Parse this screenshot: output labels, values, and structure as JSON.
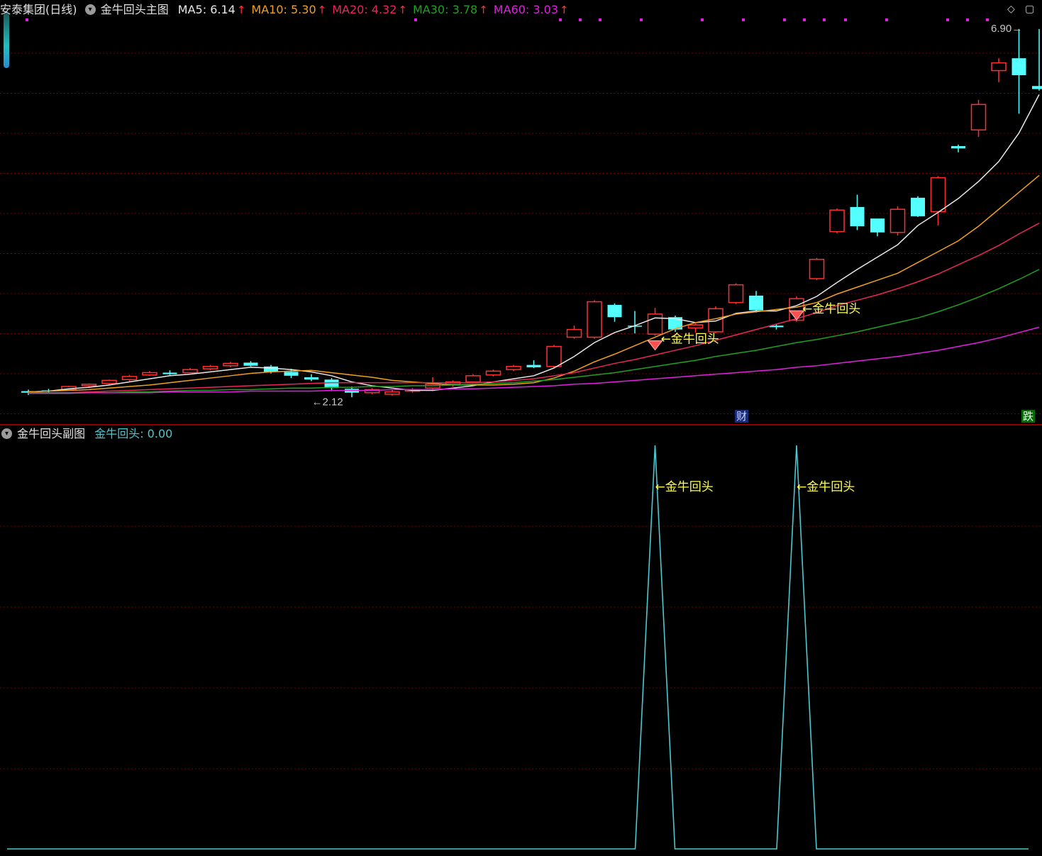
{
  "main_header": {
    "stock_title": "安泰集团(日线)",
    "indicator_name": "金牛回头主图",
    "ma_items": [
      {
        "label": "MA5: 6.14",
        "color": "#e8e8e8",
        "arrow_color": "#ff3030"
      },
      {
        "label": "MA10: 5.30",
        "color": "#f0a020",
        "arrow_color": "#ff3030"
      },
      {
        "label": "MA20: 4.32",
        "color": "#e8285a",
        "arrow_color": "#ff3030"
      },
      {
        "label": "MA30: 3.78",
        "color": "#20a020",
        "arrow_color": "#ff3030"
      },
      {
        "label": "MA60: 3.03",
        "color": "#e020e0",
        "arrow_color": "#ff3030"
      }
    ],
    "up_arrow": "↑"
  },
  "sub_header": {
    "indicator_name": "金牛回头副图",
    "value_label": "金牛回头: 0.00"
  },
  "tags": {
    "cai": "财",
    "die": "跌"
  },
  "window_buttons": {
    "diamond": "◇",
    "restore": "▢"
  },
  "colors": {
    "up": "#ff3030",
    "down": "#54ffff",
    "grid": "#7a0000",
    "signal_text": "#ffff55",
    "sub_line": "#4cc8d0",
    "separator": "#c00000",
    "dot": "#e020e0"
  },
  "chart_data": [
    {
      "type": "candlestick",
      "title": "安泰集团(日线)",
      "ylim": [
        1.8,
        7.0
      ],
      "candles": [
        [
          2.2,
          2.22,
          2.15,
          2.18
        ],
        [
          2.21,
          2.23,
          2.17,
          2.2
        ],
        [
          2.22,
          2.27,
          2.21,
          2.26
        ],
        [
          2.27,
          2.3,
          2.25,
          2.29
        ],
        [
          2.3,
          2.35,
          2.28,
          2.34
        ],
        [
          2.35,
          2.41,
          2.33,
          2.39
        ],
        [
          2.41,
          2.46,
          2.4,
          2.44
        ],
        [
          2.44,
          2.47,
          2.41,
          2.42
        ],
        [
          2.44,
          2.5,
          2.43,
          2.48
        ],
        [
          2.49,
          2.54,
          2.47,
          2.52
        ],
        [
          2.53,
          2.58,
          2.51,
          2.56
        ],
        [
          2.57,
          2.59,
          2.52,
          2.53
        ],
        [
          2.52,
          2.54,
          2.43,
          2.45
        ],
        [
          2.45,
          2.49,
          2.37,
          2.4
        ],
        [
          2.38,
          2.42,
          2.33,
          2.35
        ],
        [
          2.35,
          2.37,
          2.2,
          2.24
        ],
        [
          2.23,
          2.26,
          2.12,
          2.18
        ],
        [
          2.18,
          2.24,
          2.16,
          2.22
        ],
        [
          2.16,
          2.22,
          2.14,
          2.19
        ],
        [
          2.2,
          2.24,
          2.18,
          2.22
        ],
        [
          2.24,
          2.38,
          2.2,
          2.29
        ],
        [
          2.29,
          2.34,
          2.26,
          2.32
        ],
        [
          2.32,
          2.42,
          2.31,
          2.4
        ],
        [
          2.41,
          2.48,
          2.39,
          2.46
        ],
        [
          2.48,
          2.54,
          2.46,
          2.52
        ],
        [
          2.54,
          2.6,
          2.5,
          2.51
        ],
        [
          2.52,
          2.8,
          2.5,
          2.78
        ],
        [
          2.9,
          3.05,
          2.88,
          3.0
        ],
        [
          2.9,
          3.38,
          2.88,
          3.36
        ],
        [
          3.32,
          3.34,
          3.1,
          3.16
        ],
        [
          3.05,
          3.24,
          2.95,
          3.04
        ],
        [
          2.94,
          3.28,
          2.92,
          3.2
        ],
        [
          3.16,
          3.18,
          2.97,
          3.0
        ],
        [
          3.02,
          3.08,
          2.96,
          3.06
        ],
        [
          2.97,
          3.3,
          2.95,
          3.27
        ],
        [
          3.35,
          3.6,
          3.33,
          3.58
        ],
        [
          3.44,
          3.5,
          3.22,
          3.25
        ],
        [
          3.05,
          3.07,
          3.0,
          3.03
        ],
        [
          3.12,
          3.43,
          3.1,
          3.4
        ],
        [
          3.66,
          3.93,
          3.64,
          3.91
        ],
        [
          4.27,
          4.57,
          4.25,
          4.55
        ],
        [
          4.59,
          4.75,
          4.29,
          4.34
        ],
        [
          4.44,
          4.38,
          4.21,
          4.26
        ],
        [
          4.26,
          4.6,
          4.22,
          4.56
        ],
        [
          4.71,
          4.73,
          4.46,
          4.47
        ],
        [
          4.53,
          4.99,
          4.35,
          4.97
        ],
        [
          5.38,
          5.4,
          5.3,
          5.35
        ],
        [
          5.59,
          5.98,
          5.5,
          5.92
        ],
        [
          6.36,
          6.52,
          6.21,
          6.46
        ],
        [
          6.52,
          6.9,
          5.8,
          6.3
        ],
        [
          6.16,
          6.9,
          6.1,
          6.12
        ]
      ],
      "ma": {
        "MA5": [
          2.19,
          2.2,
          2.23,
          2.25,
          2.28,
          2.32,
          2.36,
          2.4,
          2.42,
          2.45,
          2.48,
          2.51,
          2.5,
          2.48,
          2.45,
          2.4,
          2.32,
          2.27,
          2.24,
          2.21,
          2.21,
          2.24,
          2.27,
          2.32,
          2.36,
          2.4,
          2.5,
          2.65,
          2.83,
          2.96,
          3.05,
          3.15,
          3.14,
          3.09,
          3.11,
          3.21,
          3.24,
          3.24,
          3.31,
          3.43,
          3.61,
          3.78,
          3.94,
          4.1,
          4.35,
          4.52,
          4.7,
          4.92,
          5.18,
          5.55,
          6.05
        ],
        "MA10": [
          2.19,
          2.2,
          2.21,
          2.22,
          2.24,
          2.26,
          2.28,
          2.31,
          2.34,
          2.37,
          2.4,
          2.43,
          2.45,
          2.46,
          2.47,
          2.44,
          2.41,
          2.38,
          2.34,
          2.32,
          2.3,
          2.28,
          2.28,
          2.28,
          2.29,
          2.31,
          2.37,
          2.46,
          2.58,
          2.68,
          2.79,
          2.9,
          3.01,
          3.09,
          3.14,
          3.2,
          3.23,
          3.26,
          3.29,
          3.35,
          3.46,
          3.55,
          3.64,
          3.73,
          3.87,
          4.01,
          4.15,
          4.34,
          4.56,
          4.78,
          5.0
        ],
        "MA20": [
          2.18,
          2.18,
          2.18,
          2.19,
          2.2,
          2.21,
          2.22,
          2.23,
          2.24,
          2.25,
          2.26,
          2.27,
          2.28,
          2.29,
          2.3,
          2.31,
          2.31,
          2.31,
          2.31,
          2.31,
          2.31,
          2.31,
          2.31,
          2.32,
          2.34,
          2.36,
          2.4,
          2.44,
          2.5,
          2.56,
          2.61,
          2.67,
          2.73,
          2.79,
          2.86,
          2.93,
          3.0,
          3.07,
          3.14,
          3.22,
          3.31,
          3.38,
          3.45,
          3.53,
          3.62,
          3.72,
          3.84,
          3.96,
          4.09,
          4.24,
          4.38
        ],
        "MA30": [
          2.17,
          2.17,
          2.17,
          2.18,
          2.18,
          2.19,
          2.19,
          2.2,
          2.21,
          2.21,
          2.22,
          2.22,
          2.23,
          2.24,
          2.24,
          2.25,
          2.25,
          2.26,
          2.26,
          2.27,
          2.27,
          2.28,
          2.29,
          2.3,
          2.31,
          2.33,
          2.35,
          2.38,
          2.41,
          2.44,
          2.48,
          2.52,
          2.56,
          2.6,
          2.65,
          2.69,
          2.73,
          2.78,
          2.83,
          2.87,
          2.92,
          2.97,
          3.03,
          3.09,
          3.15,
          3.23,
          3.32,
          3.42,
          3.53,
          3.65,
          3.78
        ],
        "MA60": [
          2.18,
          2.18,
          2.18,
          2.18,
          2.18,
          2.18,
          2.18,
          2.19,
          2.19,
          2.19,
          2.19,
          2.2,
          2.2,
          2.2,
          2.2,
          2.21,
          2.21,
          2.21,
          2.22,
          2.22,
          2.22,
          2.23,
          2.23,
          2.24,
          2.25,
          2.26,
          2.27,
          2.29,
          2.3,
          2.32,
          2.34,
          2.36,
          2.38,
          2.4,
          2.42,
          2.44,
          2.46,
          2.48,
          2.51,
          2.53,
          2.56,
          2.59,
          2.62,
          2.65,
          2.69,
          2.73,
          2.78,
          2.83,
          2.89,
          2.96,
          3.03
        ]
      },
      "annotations": [
        {
          "index": 31,
          "text": "金牛回头"
        },
        {
          "index": 38,
          "text": "金牛回头"
        },
        {
          "index": 15,
          "text": "2.12",
          "arrow": "←"
        },
        {
          "index": 50,
          "text": "6.90",
          "arrow": "→"
        }
      ]
    },
    {
      "type": "line",
      "title": "金牛回头副图",
      "series": [
        {
          "name": "金牛回头",
          "values": [
            0,
            0,
            0,
            0,
            0,
            0,
            0,
            0,
            0,
            0,
            0,
            0,
            0,
            0,
            0,
            0,
            0,
            0,
            0,
            0,
            0,
            0,
            0,
            0,
            0,
            0,
            0,
            0,
            0,
            0,
            0,
            1,
            0,
            0,
            0,
            0,
            0,
            0,
            1,
            0,
            0,
            0,
            0,
            0,
            0,
            0,
            0,
            0,
            0,
            0,
            0
          ]
        }
      ],
      "ylim": [
        0,
        1
      ],
      "annotations": [
        {
          "index": 31,
          "text": "金牛回头",
          "arrow": "←"
        },
        {
          "index": 38,
          "text": "金牛回头",
          "arrow": "←"
        }
      ]
    }
  ]
}
